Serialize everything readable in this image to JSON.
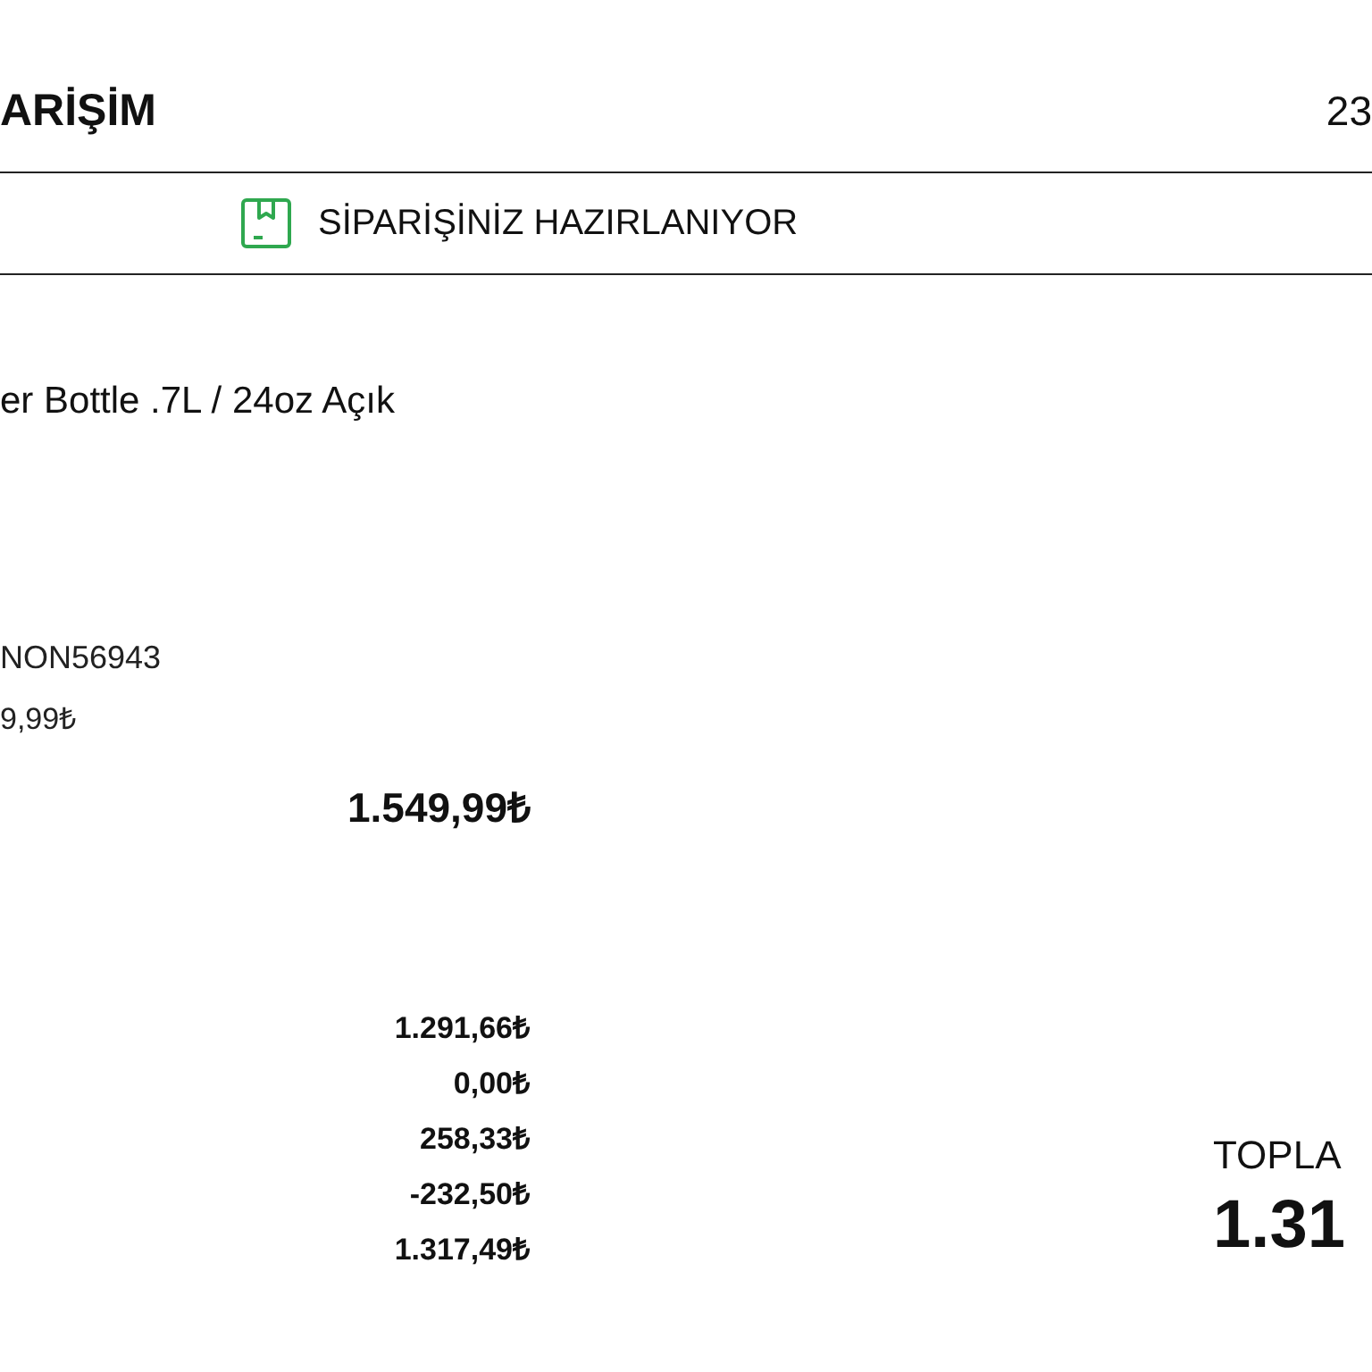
{
  "header": {
    "title": "ARİŞİM",
    "number": "23"
  },
  "status": {
    "label": "SİPARİŞİNİZ HAZIRLANIYOR"
  },
  "product": {
    "name": "er Bottle .7L / 24oz Açık",
    "code": "NON56943",
    "unit_price": "9,99₺",
    "line_total": "1.549,99₺"
  },
  "summary": {
    "values": [
      "1.291,66₺",
      "0,00₺",
      "258,33₺",
      "-232,50₺",
      "1.317,49₺"
    ]
  },
  "total": {
    "label": "TOPLA",
    "amount": "1.31"
  }
}
